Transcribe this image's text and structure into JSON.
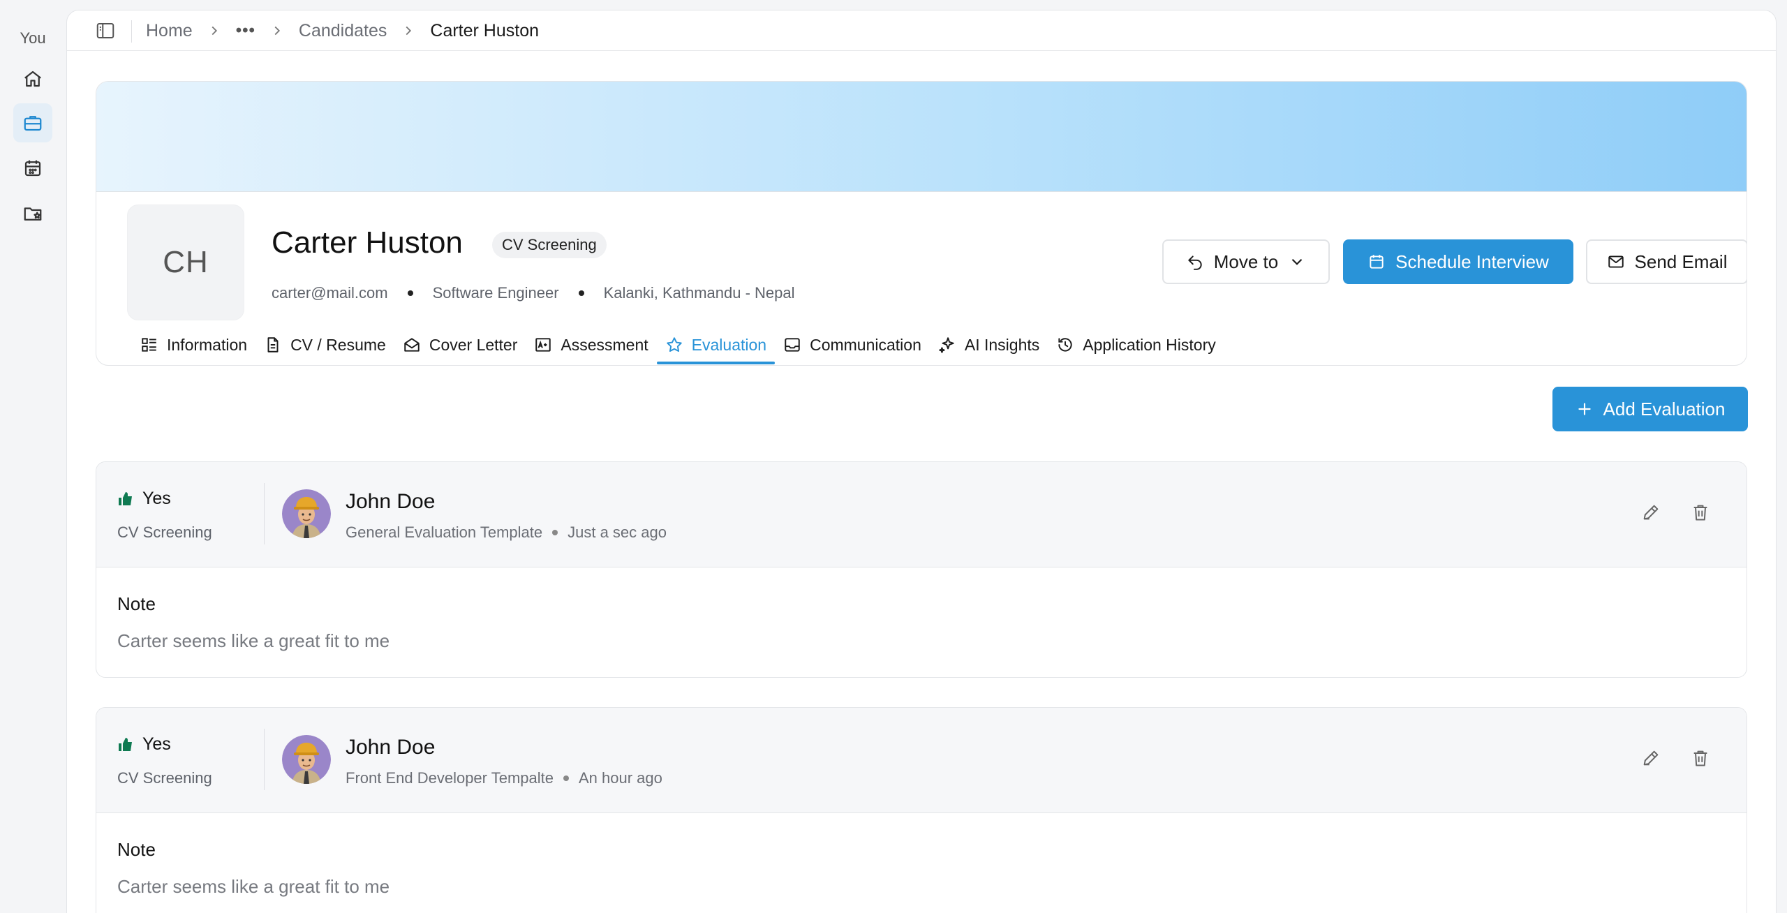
{
  "rail": {
    "user_label": "You"
  },
  "breadcrumb": {
    "home": "Home",
    "ellipsis": "•••",
    "candidates": "Candidates",
    "current": "Carter Huston"
  },
  "candidate": {
    "initials": "CH",
    "name": "Carter Huston",
    "stage": "CV Screening",
    "email": "carter@mail.com",
    "role": "Software Engineer",
    "location": "Kalanki, Kathmandu - Nepal"
  },
  "actions": {
    "move_to": "Move to",
    "schedule": "Schedule Interview",
    "send_email": "Send Email",
    "add_evaluation": "Add Evaluation"
  },
  "tabs": [
    {
      "label": "Information",
      "icon": "list-icon"
    },
    {
      "label": "CV / Resume",
      "icon": "document-icon"
    },
    {
      "label": "Cover Letter",
      "icon": "envelope-open-icon"
    },
    {
      "label": "Assessment",
      "icon": "grade-icon"
    },
    {
      "label": "Evaluation",
      "icon": "star-icon",
      "active": true
    },
    {
      "label": "Communication",
      "icon": "inbox-icon"
    },
    {
      "label": "AI Insights",
      "icon": "sparkle-icon"
    },
    {
      "label": "Application History",
      "icon": "history-icon"
    }
  ],
  "evaluations": [
    {
      "verdict": "Yes",
      "stage": "CV Screening",
      "evaluator": "John Doe",
      "template": "General Evaluation Template",
      "time": "Just a sec ago",
      "note_label": "Note",
      "note": "Carter seems like a great fit to me"
    },
    {
      "verdict": "Yes",
      "stage": "CV Screening",
      "evaluator": "John Doe",
      "template": "Front End Developer Tempalte",
      "time": "An hour ago",
      "note_label": "Note",
      "note": "Carter seems like a great fit to me"
    }
  ],
  "colors": {
    "accent": "#2993d8",
    "thumb": "#0f7a52"
  }
}
